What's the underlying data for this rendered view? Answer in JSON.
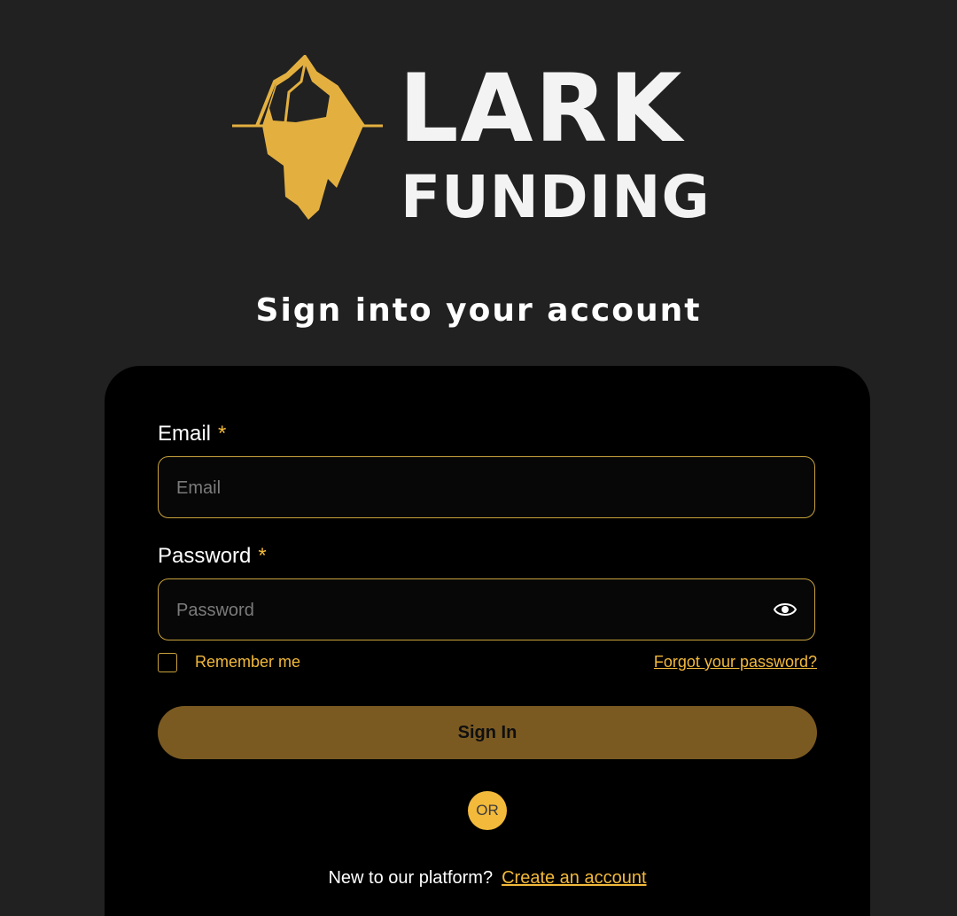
{
  "logo": {
    "line1": "LARK",
    "line2": "FUNDING"
  },
  "title": "Sign into your account",
  "email": {
    "label": "Email",
    "required_mark": "*",
    "placeholder": "Email",
    "value": ""
  },
  "password": {
    "label": "Password",
    "required_mark": "*",
    "placeholder": "Password",
    "value": ""
  },
  "remember_me": {
    "label": "Remember me",
    "checked": false
  },
  "forgot_password": "Forgot your password?",
  "sign_in_button": "Sign In",
  "or_separator": "OR",
  "signup": {
    "prompt": "New to our platform?",
    "link": "Create an account"
  },
  "colors": {
    "background": "#212121",
    "card": "#000000",
    "accent": "#f2b93b",
    "button": "#7b5a22",
    "input_border": "#c9a23d"
  },
  "icons": {
    "logo_mark": "iceberg-icon",
    "show_password": "eye-icon"
  }
}
